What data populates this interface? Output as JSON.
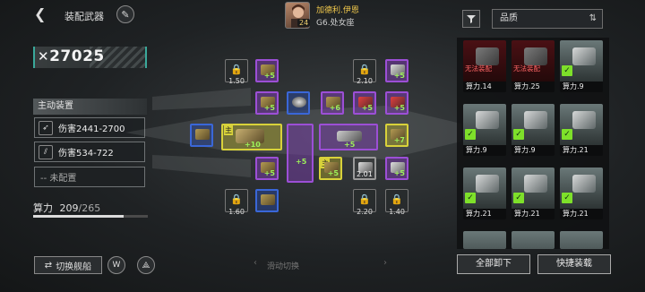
{
  "header": {
    "title": "装配武器",
    "back_icon": "chevron-left-icon",
    "edit_icon": "pencil-icon"
  },
  "pilot": {
    "name": "加德利.伊恩",
    "subtitle": "G6.处女座",
    "level": "24"
  },
  "filter": {
    "icon": "filter-icon",
    "sort_label": "品质",
    "sort_icon": "sort-icon"
  },
  "power": {
    "icon": "crossed-swords-icon",
    "value": "27025"
  },
  "active_equipment": {
    "title": "主动装置",
    "skills": [
      {
        "label": "伤害2441-2700",
        "icon": "missile-icon"
      },
      {
        "label": "伤害534-722",
        "icon": "gatling-icon"
      },
      {
        "label": "-- 未配置",
        "icon": ""
      }
    ]
  },
  "calc": {
    "label": "算力",
    "used": "209",
    "total": "/265",
    "fill": 0.79
  },
  "bottom_left": {
    "switch_ship": "切换舰船",
    "swipe_hint": "滑动切换"
  },
  "grid": {
    "lock_values": [
      "1.50",
      "2.10",
      "1.60",
      "2.20",
      "1.40",
      "2.01"
    ],
    "plus_labels": [
      "+5",
      "+5",
      "+5",
      "+6",
      "+5",
      "+5",
      "+10",
      "+5",
      "+5",
      "+7",
      "+5",
      "+5",
      "+5",
      "+5",
      "+5"
    ],
    "main_tag": "主"
  },
  "inventory": {
    "cards": [
      {
        "label": "算力.14",
        "warn": "无法装配",
        "rarity": "red"
      },
      {
        "label": "算力.25",
        "warn": "无法装配",
        "rarity": "red"
      },
      {
        "label": "算力.9",
        "warn": "",
        "rarity": "green"
      },
      {
        "label": "算力.9",
        "warn": "",
        "rarity": "green"
      },
      {
        "label": "算力.9",
        "warn": "",
        "rarity": "green"
      },
      {
        "label": "算力.21",
        "warn": "",
        "rarity": "green"
      },
      {
        "label": "算力.21",
        "warn": "",
        "rarity": "green"
      },
      {
        "label": "算力.21",
        "warn": "",
        "rarity": "green"
      },
      {
        "label": "算力.21",
        "warn": "",
        "rarity": "green"
      }
    ],
    "unequip_all": "全部卸下",
    "quick_equip": "快捷装载"
  },
  "colors": {
    "accent_teal": "#3aa89a",
    "slot_purple": "#9c4fd6",
    "slot_yellow": "#d8d23a",
    "slot_blue": "#3a67d8",
    "warn_red": "#ff6666",
    "check_green": "#7ee02a"
  }
}
